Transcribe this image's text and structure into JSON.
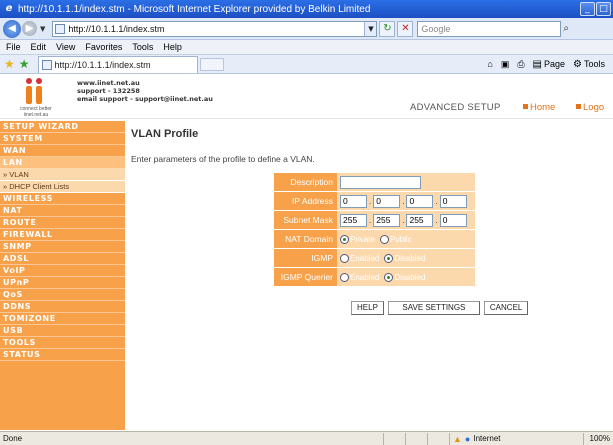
{
  "window": {
    "title": "http://10.1.1.1/index.stm - Microsoft Internet Explorer provided by Belkin Limited",
    "buttons": [
      "_",
      "□"
    ]
  },
  "address_bar": {
    "url": "http://10.1.1.1/index.stm",
    "search_placeholder": "Google"
  },
  "menu": [
    "File",
    "Edit",
    "View",
    "Favorites",
    "Tools",
    "Help"
  ],
  "tab": {
    "label": "http://10.1.1.1/index.stm"
  },
  "toolbar_right": {
    "page_label": "Page",
    "tools_label": "Tools"
  },
  "header": {
    "logo_tagline": "connect better",
    "logo_domain": "iinet.net.au",
    "contact_line1": "www.iinet.net.au",
    "contact_line2": "support - 132258",
    "contact_line3": "email support - support@iinet.net.au",
    "advanced_setup": "ADVANCED SETUP",
    "home_link": "Home",
    "logout_link": "Logo"
  },
  "sidebar": {
    "items": [
      {
        "label": "SETUP WIZARD"
      },
      {
        "label": "SYSTEM"
      },
      {
        "label": "WAN"
      },
      {
        "label": "LAN"
      }
    ],
    "subitems": [
      {
        "label": "» VLAN"
      },
      {
        "label": "» DHCP Client Lists"
      }
    ],
    "items_after": [
      {
        "label": "WIRELESS"
      },
      {
        "label": "NAT"
      },
      {
        "label": "ROUTE"
      },
      {
        "label": "FIREWALL"
      },
      {
        "label": "SNMP"
      },
      {
        "label": "ADSL"
      },
      {
        "label": "VoIP"
      },
      {
        "label": "UPnP"
      },
      {
        "label": "QoS"
      },
      {
        "label": "DDNS"
      },
      {
        "label": "TOMIZONE"
      },
      {
        "label": "USB"
      },
      {
        "label": "TOOLS"
      },
      {
        "label": "STATUS"
      }
    ]
  },
  "main": {
    "title": "VLAN Profile",
    "description": "Enter parameters of the profile to define a VLAN.",
    "form": {
      "description_label": "Description",
      "description_value": "",
      "ip_label": "IP Address",
      "ip": [
        "0",
        "0",
        "0",
        "0"
      ],
      "subnet_label": "Subnet Mask",
      "subnet": [
        "255",
        "255",
        "255",
        "0"
      ],
      "nat_label": "NAT Domain",
      "nat_options": [
        "Private",
        "Public"
      ],
      "nat_selected": "Private",
      "igmp_snooping_label": "IGMP Snooping",
      "igmp_querier_label": "IGMP Querier",
      "enable_options": [
        "Enabled",
        "Disabled"
      ],
      "igmp_snooping_selected": "Disabled",
      "igmp_querier_selected": "Disabled"
    },
    "buttons": {
      "help": "HELP",
      "save": "SAVE SETTINGS",
      "cancel": "CANCEL"
    }
  },
  "status_bar": {
    "text": "Done",
    "zone": "Internet",
    "zoom": "100%"
  }
}
